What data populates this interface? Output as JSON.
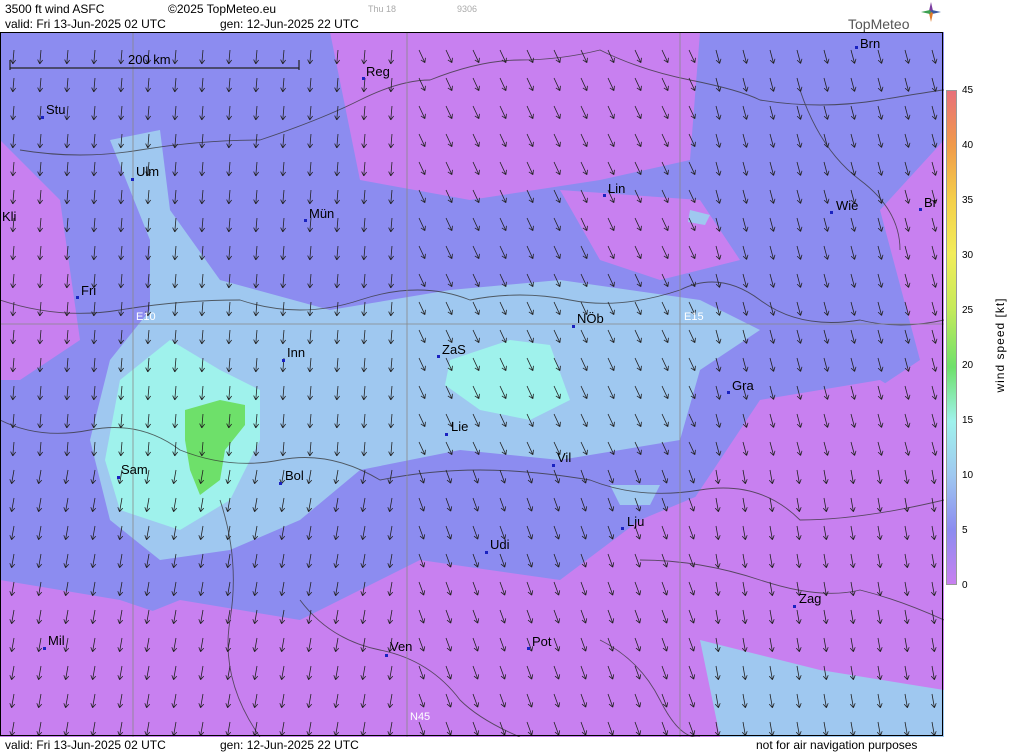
{
  "header": {
    "product": "3500 ft wind ASFC",
    "copyright": "©2025 TopMeteo.eu",
    "faint_day": "Thu 18",
    "faint_code": "9306",
    "valid": "valid:  Fri  13-Jun-2025  02 UTC",
    "generated": "gen: 12-Jun-2025 22 UTC",
    "logo": "TopMeteo"
  },
  "scale_bar": {
    "label": "200 km"
  },
  "grid_labels": [
    "E10",
    "E15",
    "N45"
  ],
  "cities": [
    {
      "name": "Brn"
    },
    {
      "name": "Reg"
    },
    {
      "name": "Stu"
    },
    {
      "name": "Ulm"
    },
    {
      "name": "Lin"
    },
    {
      "name": "Wie"
    },
    {
      "name": "Br"
    },
    {
      "name": "Kli"
    },
    {
      "name": "Mün"
    },
    {
      "name": "Fri"
    },
    {
      "name": "NÖb"
    },
    {
      "name": "Inn"
    },
    {
      "name": "ZaS"
    },
    {
      "name": "Gra"
    },
    {
      "name": "Lie"
    },
    {
      "name": "Vil"
    },
    {
      "name": "Sam"
    },
    {
      "name": "Bol"
    },
    {
      "name": "Lju"
    },
    {
      "name": "Udi"
    },
    {
      "name": "Zag"
    },
    {
      "name": "Mil"
    },
    {
      "name": "Ven"
    },
    {
      "name": "Pot"
    }
  ],
  "legend": {
    "title": "wind  speed  [kt]",
    "ticks": [
      "45",
      "40",
      "35",
      "30",
      "25",
      "20",
      "15",
      "10",
      "5",
      "0"
    ],
    "colors": [
      "#e8707a",
      "#f09a4a",
      "#f4cf4a",
      "#f2ec5a",
      "#c6ea5a",
      "#6ee06a",
      "#9ff2ec",
      "#9fc8f0",
      "#8c8cf0",
      "#c880f0"
    ]
  },
  "footer": {
    "valid": "valid:  Fri  13-Jun-2025  02 UTC",
    "generated": "gen: 12-Jun-2025 22 UTC",
    "disclaimer": "not for air navigation purposes"
  }
}
